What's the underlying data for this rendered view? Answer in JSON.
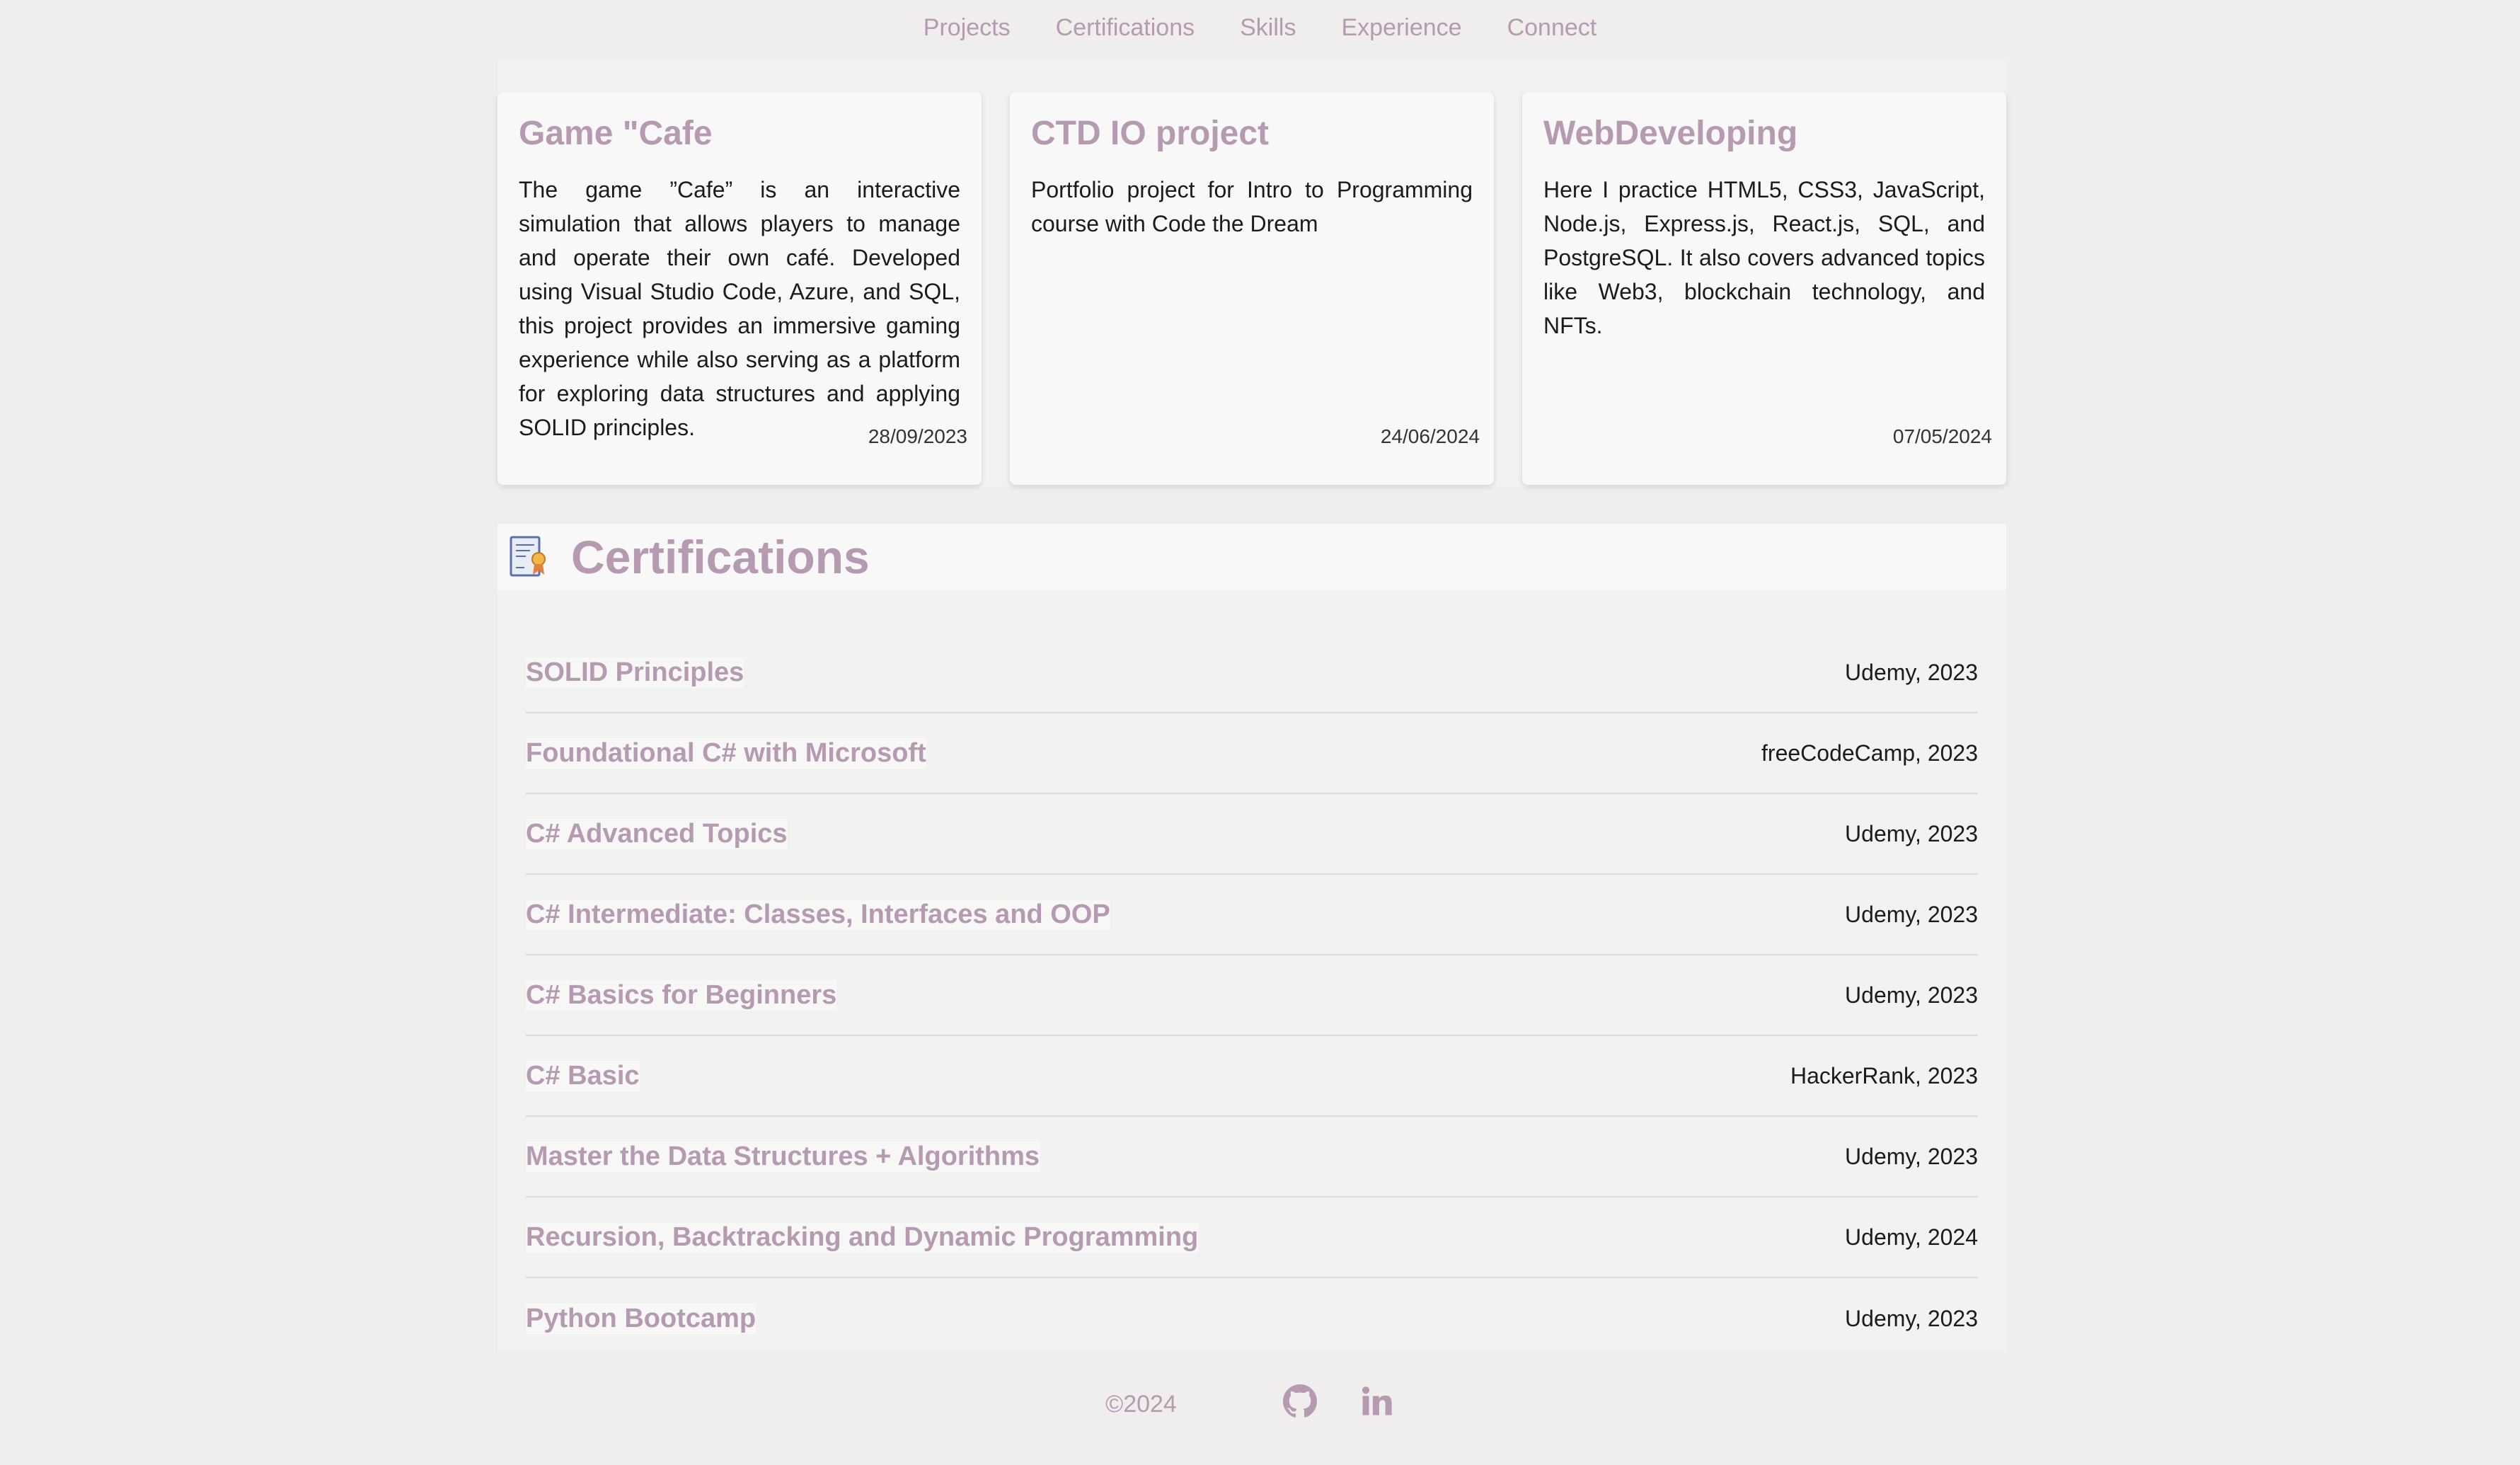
{
  "nav": {
    "items": [
      "Projects",
      "Certifications",
      "Skills",
      "Experience",
      "Connect"
    ]
  },
  "projects": [
    {
      "title": "Game \"Cafe",
      "description": "The game ”Cafe” is an interactive simulation that allows players to manage and operate their own café. Developed using Visual Studio Code, Azure, and SQL, this project provides an immersive gaming experience while also serving as a platform for exploring data structures and applying SOLID principles.",
      "date": "28/09/2023"
    },
    {
      "title": "CTD IO project",
      "description": "Portfolio project for Intro to Programming course with Code the Dream",
      "date": "24/06/2024"
    },
    {
      "title": "WebDeveloping",
      "description": "Here I practice HTML5, CSS3, JavaScript, Node.js, Express.js, React.js, SQL, and PostgreSQL. It also covers advanced topics like Web3, blockchain technology, and NFTs.",
      "date": "07/05/2024"
    }
  ],
  "certifications": {
    "heading": "Certifications",
    "icon": "certificate-icon",
    "items": [
      {
        "name": "SOLID Principles",
        "source": "Udemy, 2023"
      },
      {
        "name": "Foundational C# with Microsoft",
        "source": "freeCodeCamp, 2023"
      },
      {
        "name": "C# Advanced Topics",
        "source": "Udemy, 2023"
      },
      {
        "name": "C# Intermediate: Classes, Interfaces and OOP",
        "source": "Udemy, 2023"
      },
      {
        "name": "C# Basics for Beginners",
        "source": "Udemy, 2023"
      },
      {
        "name": "C# Basic",
        "source": "HackerRank, 2023"
      },
      {
        "name": "Master the Data Structures + Algorithms",
        "source": "Udemy, 2023"
      },
      {
        "name": "Recursion, Backtracking and Dynamic Programming",
        "source": "Udemy, 2024"
      },
      {
        "name": "Python Bootcamp",
        "source": "Udemy, 2023"
      }
    ]
  },
  "footer": {
    "copyright": "©2024",
    "icons": [
      "github-icon",
      "linkedin-icon"
    ]
  },
  "colors": {
    "accent": "#b59ab1",
    "background": "#efeeed",
    "card": "#f8f8f8"
  }
}
